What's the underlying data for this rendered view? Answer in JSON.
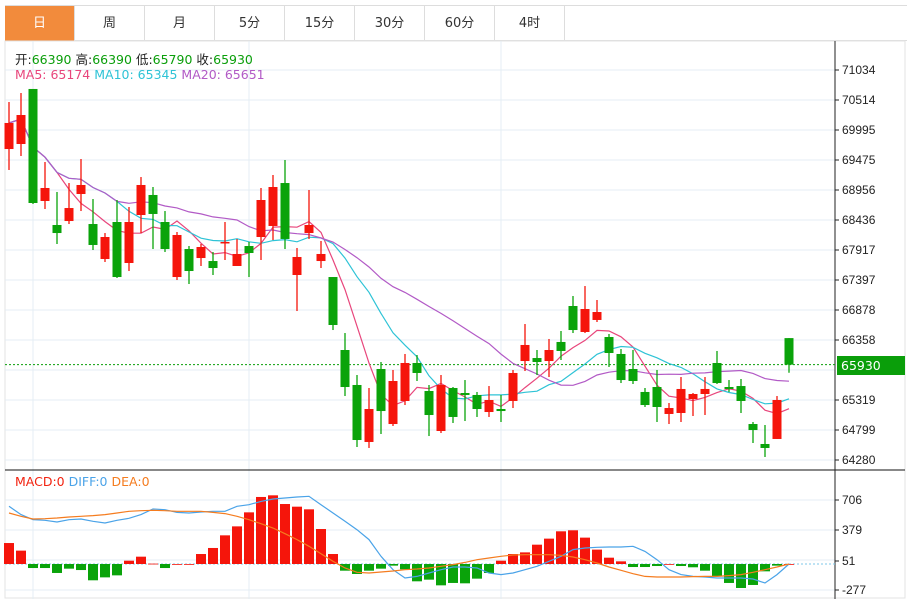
{
  "tabs": [
    {
      "label": "日",
      "active": true
    },
    {
      "label": "周"
    },
    {
      "label": "月"
    },
    {
      "label": "5分"
    },
    {
      "label": "15分"
    },
    {
      "label": "30分"
    },
    {
      "label": "60分"
    },
    {
      "label": "4时"
    }
  ],
  "ohlc_legend": {
    "open_label": "开:",
    "open": "66390",
    "high_label": "高:",
    "high": "66390",
    "low_label": "低:",
    "low": "65790",
    "close_label": "收:",
    "close": "65930"
  },
  "ma_legend": {
    "ma5": "MA5: 65174",
    "ma10": "MA10: 65345",
    "ma20": "MA20: 65651"
  },
  "macd_legend": {
    "macd": "MACD:0",
    "diff": "DIFF:0",
    "dea": "DEA:0"
  },
  "current_price": "65930",
  "colors": {
    "up": "#f5150b",
    "down": "#0aa30a",
    "ma5": "#e8467c",
    "ma10": "#2ec3d6",
    "ma20": "#b25ac6",
    "diff": "#4aa3e8",
    "dea": "#f57c1f",
    "tab_active": "#f28b3c"
  },
  "chart_data": {
    "type": "candlestick",
    "price_axis_ticks": [
      "71034",
      "70514",
      "69995",
      "69475",
      "68956",
      "68436",
      "67917",
      "67397",
      "66878",
      "66358",
      "65319",
      "64799",
      "64280"
    ],
    "macd_axis_ticks": [
      "706",
      "379",
      "51",
      "-277"
    ],
    "candles": [
      [
        69665,
        70479,
        69302,
        70116
      ],
      [
        69752,
        70635,
        69544,
        70254
      ],
      [
        70705,
        70705,
        68713,
        68730
      ],
      [
        68765,
        69440,
        68626,
        68990
      ],
      [
        68349,
        68921,
        68020,
        68210
      ],
      [
        68418,
        69076,
        68366,
        68643
      ],
      [
        68886,
        69492,
        68591,
        69042
      ],
      [
        68366,
        68799,
        67916,
        68003
      ],
      [
        67760,
        68210,
        67708,
        68141
      ],
      [
        68401,
        68782,
        67431,
        67448
      ],
      [
        67691,
        68661,
        67552,
        68401
      ],
      [
        68522,
        69180,
        68210,
        69042
      ],
      [
        68869,
        69007,
        67933,
        68540
      ],
      [
        68401,
        68591,
        67881,
        67933
      ],
      [
        67448,
        68228,
        67396,
        68176
      ],
      [
        67933,
        67985,
        67327,
        67552
      ],
      [
        67777,
        68020,
        67639,
        67968
      ],
      [
        67725,
        67881,
        67483,
        67604
      ],
      [
        68037,
        68401,
        67743,
        68055
      ],
      [
        67639,
        68107,
        67639,
        67847
      ],
      [
        67985,
        68055,
        67448,
        67864
      ],
      [
        68141,
        68990,
        67743,
        68782
      ],
      [
        68332,
        69215,
        68089,
        69007
      ],
      [
        69076,
        69475,
        67933,
        68107
      ],
      [
        67483,
        67951,
        66859,
        67795
      ],
      [
        68210,
        68955,
        68107,
        68349
      ],
      [
        67725,
        68072,
        67604,
        67847
      ],
      [
        67448,
        67448,
        66530,
        66617
      ],
      [
        66184,
        66478,
        65387,
        65543
      ],
      [
        65578,
        65751,
        64504,
        64625
      ],
      [
        64591,
        65526,
        64487,
        65162
      ],
      [
        65855,
        65976,
        64729,
        65127
      ],
      [
        64902,
        65838,
        64868,
        65647
      ],
      [
        65301,
        66115,
        65231,
        65959
      ],
      [
        65959,
        66097,
        65647,
        65786
      ],
      [
        65474,
        65578,
        64694,
        65058
      ],
      [
        64781,
        65751,
        64746,
        65578
      ],
      [
        65526,
        65543,
        64920,
        65024
      ],
      [
        65439,
        65664,
        64954,
        65405
      ],
      [
        65405,
        65457,
        65024,
        65162
      ],
      [
        65110,
        65560,
        65024,
        65318
      ],
      [
        65162,
        65405,
        64937,
        65127
      ],
      [
        65301,
        65838,
        65179,
        65786
      ],
      [
        65993,
        66634,
        65820,
        66271
      ],
      [
        66045,
        66184,
        65751,
        65976
      ],
      [
        65993,
        66375,
        65716,
        66184
      ],
      [
        66323,
        66513,
        66011,
        66167
      ],
      [
        66946,
        67119,
        66478,
        66530
      ],
      [
        66496,
        67292,
        66478,
        66894
      ],
      [
        66704,
        67050,
        66669,
        66842
      ],
      [
        66409,
        66461,
        65890,
        66132
      ],
      [
        66115,
        66201,
        65612,
        65664
      ],
      [
        65855,
        66184,
        65595,
        65647
      ],
      [
        65457,
        65526,
        65197,
        65231
      ],
      [
        65543,
        65838,
        64937,
        65197
      ],
      [
        65076,
        65266,
        64902,
        65179
      ],
      [
        65093,
        65716,
        64937,
        65509
      ],
      [
        65335,
        65439,
        65041,
        65422
      ],
      [
        65422,
        65716,
        65058,
        65509
      ],
      [
        65959,
        66167,
        65595,
        65612
      ],
      [
        65543,
        65664,
        65457,
        65509
      ],
      [
        65560,
        65682,
        65093,
        65301
      ],
      [
        64902,
        64937,
        64573,
        64798
      ],
      [
        64556,
        64885,
        64331,
        64487
      ],
      [
        64643,
        65387,
        64643,
        65318
      ],
      [
        66390,
        66390,
        65790,
        65930
      ]
    ],
    "macd_hist": [
      229,
      146,
      -44,
      -44,
      -98,
      -51,
      -66,
      -178,
      -146,
      -124,
      36,
      80,
      4,
      -44,
      0,
      0,
      109,
      175,
      313,
      411,
      564,
      732,
      750,
      655,
      626,
      597,
      382,
      109,
      -73,
      -109,
      -73,
      -51,
      -18,
      -58,
      -189,
      -171,
      -233,
      -207,
      -211,
      -160,
      -98,
      36,
      109,
      127,
      211,
      277,
      357,
      368,
      288,
      157,
      69,
      29,
      -33,
      -33,
      -22,
      0,
      -22,
      -36,
      -73,
      -135,
      -207,
      -262,
      -229,
      -80,
      -18,
      0
    ],
    "diff": [
      630,
      539,
      484,
      477,
      459,
      484,
      491,
      466,
      448,
      477,
      499,
      539,
      601,
      593,
      564,
      557,
      568,
      575,
      575,
      630,
      648,
      684,
      710,
      721,
      732,
      739,
      648,
      557,
      466,
      375,
      266,
      84,
      -62,
      -153,
      -135,
      -98,
      -62,
      -33,
      -33,
      -44,
      -98,
      -116,
      -98,
      -62,
      -25,
      29,
      84,
      157,
      175,
      182,
      186,
      186,
      193,
      138,
      47,
      -62,
      -116,
      -135,
      -142,
      -153,
      -153,
      -153,
      -164,
      -207,
      -116,
      0
    ],
    "dea": [
      557,
      521,
      491,
      495,
      502,
      513,
      521,
      528,
      539,
      557,
      575,
      582,
      586,
      582,
      575,
      575,
      575,
      564,
      550,
      521,
      484,
      440,
      393,
      331,
      266,
      193,
      113,
      29,
      -44,
      -91,
      -98,
      -87,
      -76,
      -62,
      -55,
      -44,
      -25,
      -7,
      18,
      47,
      66,
      84,
      98,
      102,
      102,
      102,
      95,
      76,
      47,
      11,
      -33,
      -69,
      -106,
      -135,
      -142,
      -142,
      -142,
      -138,
      -135,
      -135,
      -127,
      -116,
      -91,
      -62,
      -33,
      0
    ]
  }
}
